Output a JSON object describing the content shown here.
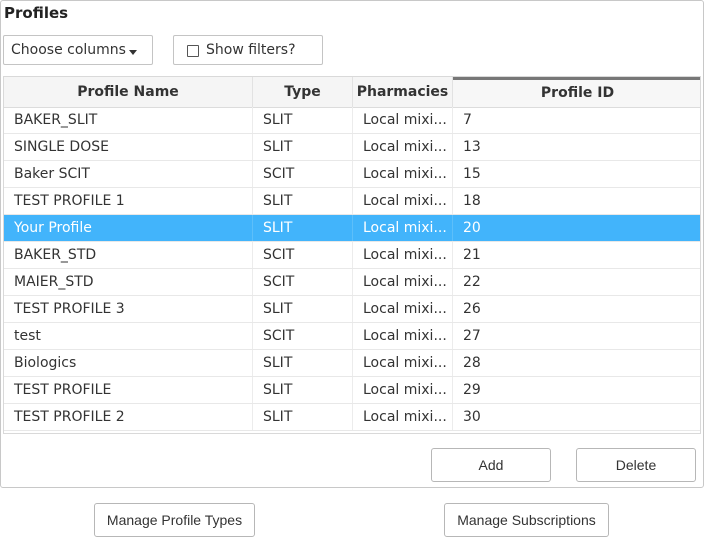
{
  "panel": {
    "title": "Profiles"
  },
  "toolbar": {
    "choose_columns_label": "Choose columns",
    "show_filters_label": "Show filters?",
    "show_filters_checked": false
  },
  "grid": {
    "columns": [
      {
        "key": "name",
        "label": "Profile Name"
      },
      {
        "key": "type",
        "label": "Type"
      },
      {
        "key": "pharmacies",
        "label": "Pharmacies"
      },
      {
        "key": "id",
        "label": "Profile ID",
        "sorted": true
      }
    ],
    "selected_row": 4,
    "rows": [
      {
        "name": "BAKER_SLIT",
        "type": "SLIT",
        "pharmacies": "Local mixi...",
        "id": "7"
      },
      {
        "name": "SINGLE DOSE",
        "type": "SLIT",
        "pharmacies": "Local mixi...",
        "id": "13"
      },
      {
        "name": "Baker SCIT",
        "type": "SCIT",
        "pharmacies": "Local mixi...",
        "id": "15"
      },
      {
        "name": "TEST PROFILE 1",
        "type": "SLIT",
        "pharmacies": "Local mixi...",
        "id": "18"
      },
      {
        "name": "Your Profile",
        "type": "SLIT",
        "pharmacies": "Local mixi...",
        "id": "20"
      },
      {
        "name": "BAKER_STD",
        "type": "SCIT",
        "pharmacies": "Local mixi...",
        "id": "21"
      },
      {
        "name": "MAIER_STD",
        "type": "SCIT",
        "pharmacies": "Local mixi...",
        "id": "22"
      },
      {
        "name": "TEST PROFILE 3",
        "type": "SLIT",
        "pharmacies": "Local mixi...",
        "id": "26"
      },
      {
        "name": "test",
        "type": "SCIT",
        "pharmacies": "Local mixi...",
        "id": "27"
      },
      {
        "name": "Biologics",
        "type": "SLIT",
        "pharmacies": "Local mixi...",
        "id": "28"
      },
      {
        "name": "TEST PROFILE",
        "type": "SLIT",
        "pharmacies": "Local mixi...",
        "id": "29"
      },
      {
        "name": "TEST PROFILE 2",
        "type": "SLIT",
        "pharmacies": "Local mixi...",
        "id": "30"
      }
    ]
  },
  "actions": {
    "add_label": "Add",
    "delete_label": "Delete"
  },
  "footer": {
    "manage_types_label": "Manage Profile Types",
    "manage_subscriptions_label": "Manage Subscriptions"
  },
  "colors": {
    "selected_row": "#42b4fb",
    "selected_text": "#ffffff"
  }
}
